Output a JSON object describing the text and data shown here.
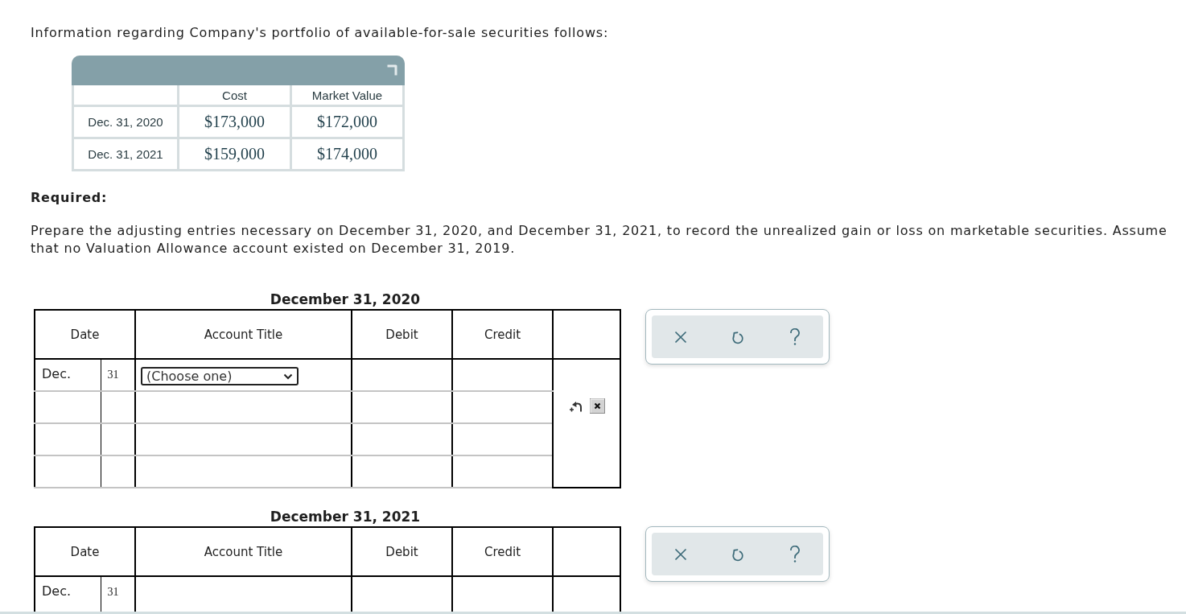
{
  "intro": "Information regarding Company's portfolio of available-for-sale securities follows:",
  "securities_table": {
    "columns": [
      "Cost",
      "Market Value"
    ],
    "rows": [
      {
        "date": "Dec. 31, 2020",
        "cost": "$173,000",
        "market_value": "$172,000"
      },
      {
        "date": "Dec. 31, 2021",
        "cost": "$159,000",
        "market_value": "$174,000"
      }
    ]
  },
  "required": {
    "heading": "Required:",
    "text": "Prepare the adjusting entries necessary on December 31, 2020, and December 31, 2021, to record the unrealized gain or loss on marketable securities. Assume that no Valuation Allowance account existed on December 31, 2019."
  },
  "journals": [
    {
      "title": "December 31, 2020",
      "columns": [
        "Date",
        "Account Title",
        "Debit",
        "Credit"
      ],
      "row_tools": true,
      "rows": [
        {
          "kind": "entry",
          "month": "Dec.",
          "day": "31",
          "account": {
            "placeholder": "(Choose one)"
          }
        },
        {
          "kind": "blank"
        },
        {
          "kind": "blank"
        },
        {
          "kind": "blank"
        }
      ]
    },
    {
      "title": "December 31, 2021",
      "columns": [
        "Date",
        "Account Title",
        "Debit",
        "Credit"
      ],
      "rows": [
        {
          "kind": "dated",
          "month": "Dec.",
          "day": "31"
        }
      ]
    }
  ]
}
